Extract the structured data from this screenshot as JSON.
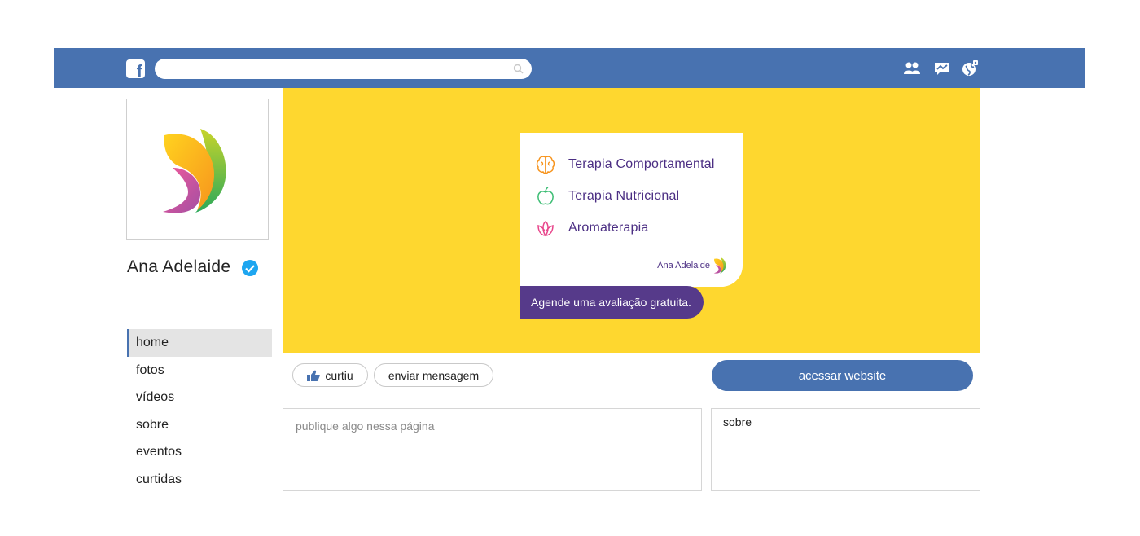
{
  "colors": {
    "topbar": "#4872b0",
    "cover": "#fed72f",
    "brand_purple": "#4b2e83",
    "cta_purple": "#563a8a",
    "verified_blue": "#1ea6f0"
  },
  "topbar": {
    "logo_letter": "f",
    "search": {
      "value": "",
      "placeholder": ""
    },
    "icons": [
      "friends-icon",
      "messages-icon",
      "globe-notifications-icon"
    ]
  },
  "profile": {
    "name": "Ana Adelaide",
    "verified": true
  },
  "nav": {
    "items": [
      {
        "label": "home",
        "active": true
      },
      {
        "label": "fotos"
      },
      {
        "label": "vídeos"
      },
      {
        "label": "sobre"
      },
      {
        "label": "eventos"
      },
      {
        "label": "curtidas"
      }
    ]
  },
  "cover": {
    "services": [
      {
        "label": "Terapia Comportamental",
        "icon": "brain-icon"
      },
      {
        "label": "Terapia Nutricional",
        "icon": "apple-icon"
      },
      {
        "label": "Aromaterapia",
        "icon": "lotus-icon"
      }
    ],
    "brand_name": "Ana Adelaide",
    "cta": "Agende uma avaliação gratuita."
  },
  "actions": {
    "like_label": "curtiu",
    "message_label": "enviar mensagem",
    "website_label": "acessar website"
  },
  "post": {
    "placeholder": "publique algo nessa página"
  },
  "about": {
    "title": "sobre"
  }
}
